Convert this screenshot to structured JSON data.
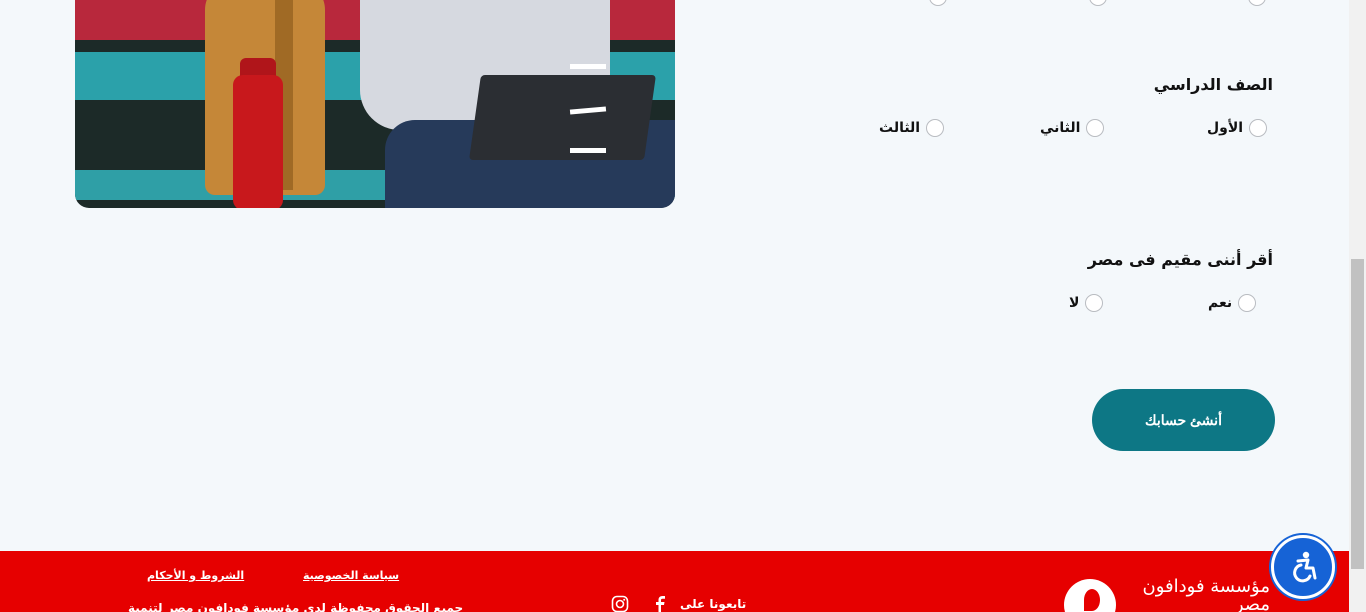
{
  "form": {
    "prev_options_partial": [
      "",
      "",
      ""
    ],
    "grade": {
      "question": "الصف الدراسي",
      "options": [
        "الأول",
        "الثاني",
        "الثالث"
      ]
    },
    "residency": {
      "question": "أقر أننى مقيم فى مصر",
      "options": [
        "نعم",
        "لا"
      ]
    },
    "submit_label": "أنشئ حسابك"
  },
  "footer": {
    "privacy": "سياسة الخصوصية",
    "terms": "الشروط و الأحكام",
    "follow_us": "تابعونا على",
    "rights": "جميع الحقوق محفوظة لدى مؤسسة فودافون مصر لتنمية",
    "logo_text": "مؤسسة فودافون مصر"
  },
  "colors": {
    "accent": "#0d7785",
    "footer": "#e60000",
    "a11y": "#1663d6"
  },
  "icons": [
    "facebook-icon",
    "instagram-icon",
    "accessibility-icon",
    "vodafone-logo"
  ]
}
